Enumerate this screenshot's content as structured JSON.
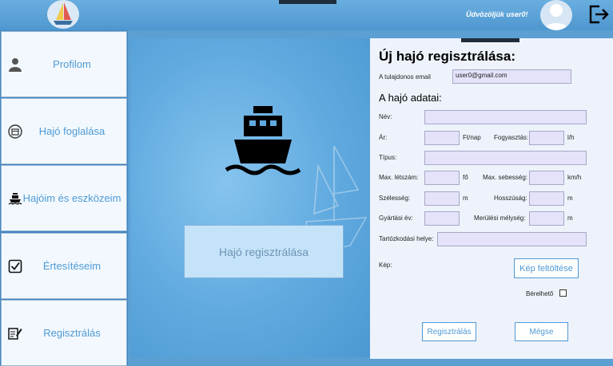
{
  "header": {
    "welcome": "Üdvözöljük user0!"
  },
  "sidebar": {
    "items": [
      {
        "label": "Profilom",
        "icon": "user-icon"
      },
      {
        "label": "Hajó foglalása",
        "icon": "calendar-icon"
      },
      {
        "label": "Hajóim és eszközeim",
        "icon": "ship-icon"
      },
      {
        "label": "Értesítéseim",
        "icon": "checkbox-icon"
      },
      {
        "label": "Regisztrálás",
        "icon": "edit-icon"
      }
    ]
  },
  "center": {
    "register_tile": "Hajó regisztrálása"
  },
  "form": {
    "title": "Új hajó regisztrálása:",
    "owner_email_label": "A tulajdonos email",
    "owner_email_value": "user0@gmail.com",
    "section_title": "A hajó adatai:",
    "name_label": "Név:",
    "price_label": "Ár:",
    "price_unit": "Ft/nap",
    "consumption_label": "Fogyasztás:",
    "consumption_unit": "l/h",
    "type_label": "Típus:",
    "max_people_label": "Max. létszám:",
    "max_people_unit": "fő",
    "max_speed_label": "Max. sebesség:",
    "max_speed_unit": "km/h",
    "width_label": "Szélesség:",
    "width_unit": "m",
    "length_label": "Hosszúság:",
    "length_unit": "m",
    "year_label": "Gyártási év:",
    "draft_label": "Merülési mélység:",
    "draft_unit": "m",
    "home_port_label": "Tartózkodási helye:",
    "image_label": "Kép:",
    "upload_button": "Kép feltöltése",
    "rentable_label": "Bérelhető",
    "register_button": "Regisztrálás",
    "cancel_button": "Mégse"
  },
  "colors": {
    "accent": "#4f9ad6",
    "input_bg": "#e4e3fa",
    "topbar": "#5b9fd3"
  }
}
